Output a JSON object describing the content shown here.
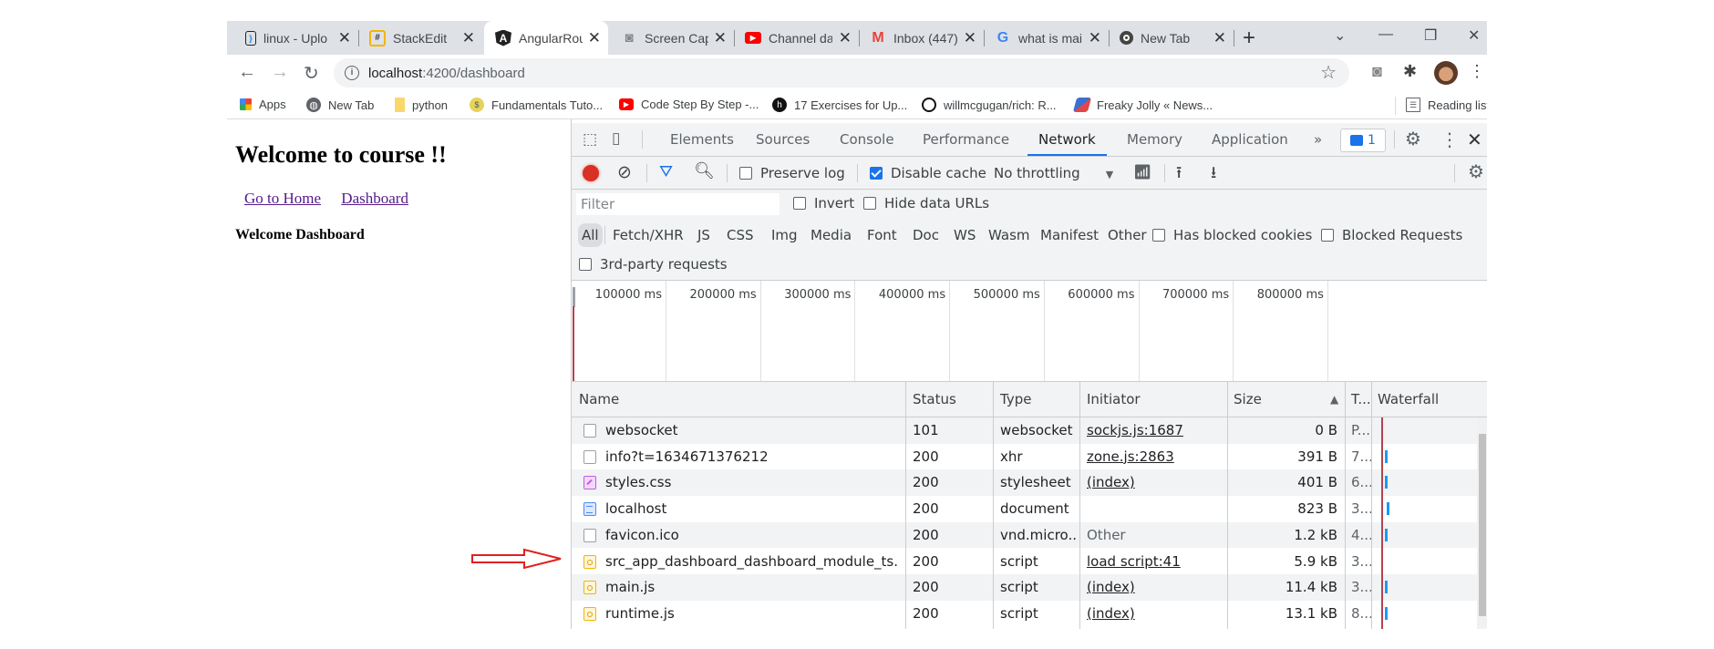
{
  "browser": {
    "tabs": [
      {
        "title": "linux - Uplo",
        "icon": "stackedit-bracket-icon",
        "active": false
      },
      {
        "title": "StackEdit",
        "icon": "stackedit-icon",
        "active": false
      },
      {
        "title": "AngularRou",
        "icon": "angular-icon",
        "active": true
      },
      {
        "title": "Screen Capt",
        "icon": "camera-icon",
        "active": false
      },
      {
        "title": "Channel da",
        "icon": "youtube-icon",
        "active": false
      },
      {
        "title": "Inbox (447)",
        "icon": "gmail-icon",
        "active": false
      },
      {
        "title": "what is mai",
        "icon": "google-icon",
        "active": false
      },
      {
        "title": "New Tab",
        "icon": "chrome-icon",
        "active": false
      }
    ],
    "new_tab_label": "+",
    "address": {
      "host": "localhost",
      "rest": ":4200/dashboard"
    },
    "bookmarks": [
      {
        "label": "Apps",
        "icon": "apps-grid-icon"
      },
      {
        "label": "New Tab",
        "icon": "globe-icon"
      },
      {
        "label": "python",
        "icon": "folder-icon"
      },
      {
        "label": "Fundamentals Tuto...",
        "icon": "coin-icon"
      },
      {
        "label": "Code Step By Step -...",
        "icon": "youtube-icon"
      },
      {
        "label": "17 Exercises for Up...",
        "icon": "medium-icon"
      },
      {
        "label": "willmcgugan/rich: R...",
        "icon": "github-icon"
      },
      {
        "label": "Freaky Jolly « News...",
        "icon": "freakyjolly-icon"
      }
    ],
    "reading_list": "Reading list"
  },
  "page": {
    "heading": "Welcome to course !!",
    "links": [
      "Go to Home",
      "Dashboard"
    ],
    "subheading": "Welcome Dashboard"
  },
  "devtools": {
    "tabs": [
      "Elements",
      "Sources",
      "Console",
      "Performance",
      "Network",
      "Memory",
      "Application"
    ],
    "active_tab": "Network",
    "more_tabs": "»",
    "message_count": "1",
    "toolbar": {
      "preserve_log": {
        "label": "Preserve log",
        "checked": false
      },
      "disable_cache": {
        "label": "Disable cache",
        "checked": true
      },
      "throttling": "No throttling"
    },
    "filter": {
      "placeholder": "Filter",
      "invert": "Invert",
      "hide_data_urls": "Hide data URLs"
    },
    "types": [
      "All",
      "Fetch/XHR",
      "JS",
      "CSS",
      "Img",
      "Media",
      "Font",
      "Doc",
      "WS",
      "Wasm",
      "Manifest",
      "Other"
    ],
    "active_type": "All",
    "has_blocked_cookies": "Has blocked cookies",
    "blocked_requests": "Blocked Requests",
    "third_party": "3rd-party requests",
    "timeline_ticks": [
      "100000 ms",
      "200000 ms",
      "300000 ms",
      "400000 ms",
      "500000 ms",
      "600000 ms",
      "700000 ms",
      "800000 ms"
    ],
    "columns": [
      "Name",
      "Status",
      "Type",
      "Initiator",
      "Size",
      "T...",
      "Waterfall"
    ],
    "sort_indicator": "▲",
    "rows": [
      {
        "name": "websocket",
        "icon": "generic",
        "status": "101",
        "type": "websocket",
        "initiator": "sockjs.js:1687",
        "initiator_link": true,
        "size": "0 B",
        "time": "P..."
      },
      {
        "name": "info?t=1634671376212",
        "icon": "generic",
        "status": "200",
        "type": "xhr",
        "initiator": "zone.js:2863",
        "initiator_link": true,
        "size": "391 B",
        "time": "7..."
      },
      {
        "name": "styles.css",
        "icon": "css",
        "status": "200",
        "type": "stylesheet",
        "initiator": "(index)",
        "initiator_link": true,
        "size": "401 B",
        "time": "6..."
      },
      {
        "name": "localhost",
        "icon": "doc",
        "status": "200",
        "type": "document",
        "initiator": "",
        "initiator_link": false,
        "size": "823 B",
        "time": "3..."
      },
      {
        "name": "favicon.ico",
        "icon": "generic",
        "status": "200",
        "type": "vnd.micro...",
        "initiator": "Other",
        "initiator_link": false,
        "size": "1.2 kB",
        "time": "4..."
      },
      {
        "name": "src_app_dashboard_dashboard_module_ts.js",
        "icon": "js",
        "status": "200",
        "type": "script",
        "initiator": "load script:41",
        "initiator_link": true,
        "size": "5.9 kB",
        "time": "3..."
      },
      {
        "name": "main.js",
        "icon": "js",
        "status": "200",
        "type": "script",
        "initiator": "(index)",
        "initiator_link": true,
        "size": "11.4 kB",
        "time": "3..."
      },
      {
        "name": "runtime.js",
        "icon": "js",
        "status": "200",
        "type": "script",
        "initiator": "(index)",
        "initiator_link": true,
        "size": "13.1 kB",
        "time": "8..."
      }
    ]
  },
  "annotation": {
    "arrow_color": "#e02020",
    "points_to": "src_app_dashboard_dashboard_module_ts.js"
  }
}
